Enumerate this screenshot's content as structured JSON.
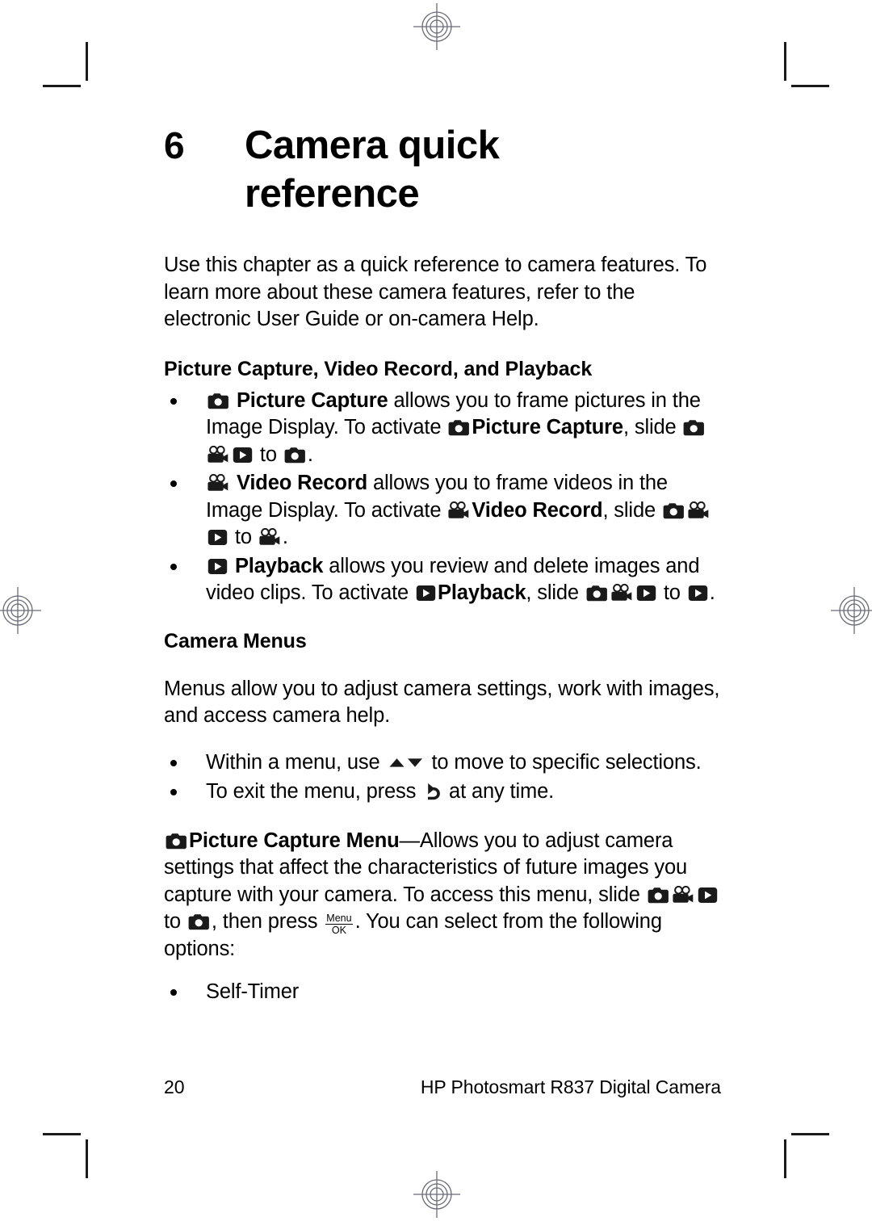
{
  "document": {
    "chapter_number": "6",
    "chapter_title": "Camera quick reference",
    "page_number": "20",
    "footer_text": "HP Photosmart R837 Digital Camera"
  },
  "intro": {
    "text": "Use this chapter as a quick reference to camera features. To learn more about these camera features, refer to the electronic User Guide or on-camera Help."
  },
  "section_capture": {
    "heading": "Picture Capture, Video Record, and Playback",
    "bullets": [
      {
        "icon": "camera-icon",
        "bold_label": "Picture Capture",
        "text_1": " allows you to frame pictures in the Image Display. To activate ",
        "bold_label_2": "Picture Capture",
        "text_2": ", slide ",
        "switch_icons": [
          "camera-icon",
          "video-camera-icon",
          "playback-icon"
        ],
        "text_3": " to ",
        "target_icon": "camera-icon",
        "text_4": "."
      },
      {
        "icon": "video-camera-icon",
        "bold_label": "Video Record",
        "text_1": " allows you to frame videos in the Image Display. To activate ",
        "bold_label_2": "Video Record",
        "text_2": ", slide ",
        "switch_icons": [
          "camera-icon",
          "video-camera-icon",
          "playback-icon"
        ],
        "text_3": " to ",
        "target_icon": "video-camera-icon",
        "text_4": "."
      },
      {
        "icon": "playback-icon",
        "bold_label": "Playback",
        "text_1": " allows you review and delete images and video clips. To activate ",
        "bold_label_2": "Playback",
        "text_2": ", slide ",
        "switch_icons": [
          "camera-icon",
          "video-camera-icon",
          "playback-icon"
        ],
        "text_3": " to ",
        "target_icon": "playback-icon",
        "text_4": "."
      }
    ]
  },
  "section_menus": {
    "heading": "Camera Menus",
    "intro": "Menus allow you to adjust camera settings, work with images, and access camera help.",
    "bullets": [
      {
        "text_1": "Within a menu, use ",
        "icon": "up-down-arrows-icon",
        "text_2": " to move to specific selections."
      },
      {
        "text_1": "To exit the menu, press ",
        "icon": "back-arrow-icon",
        "text_2": " at any time."
      }
    ],
    "capture_menu": {
      "icon": "camera-icon",
      "bold_label": "Picture Capture Menu",
      "text_1": "—Allows you to adjust camera settings that affect the characteristics of future images you capture with your camera. To access this menu, slide ",
      "switch_icons": [
        "camera-icon",
        "video-camera-icon",
        "playback-icon"
      ],
      "text_2": " to ",
      "target_icon": "camera-icon",
      "text_3": ", then press ",
      "key_icon": {
        "name": "menu-ok-key-icon",
        "top": "Menu",
        "bottom": "OK"
      },
      "text_4": ". You can select from the following options:",
      "options": [
        "Self-Timer"
      ]
    }
  },
  "colors": {
    "text": "#000000",
    "crop_mark": "#1a1a1a",
    "registration_mark": "#6b6b78",
    "background": "#ffffff"
  }
}
